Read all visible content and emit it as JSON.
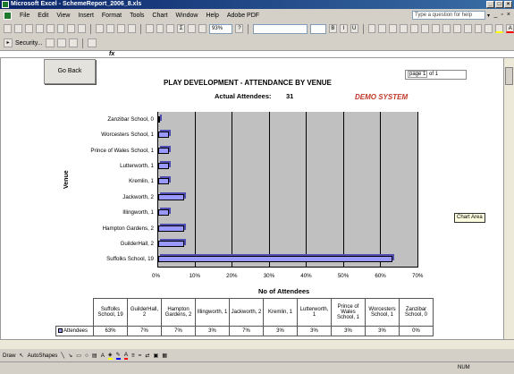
{
  "window": {
    "title": "Microsoft Excel - SchemeReport_2006_8.xls"
  },
  "menu": {
    "items": [
      "File",
      "Edit",
      "View",
      "Insert",
      "Format",
      "Tools",
      "Chart",
      "Window",
      "Help",
      "Adobe PDF"
    ]
  },
  "help_box": {
    "placeholder": "Type a question for help"
  },
  "toolbar": {
    "zoom": "93%",
    "security_label": "Security..."
  },
  "formula_bar": {
    "fx": "fx"
  },
  "report": {
    "go_back": "Go Back",
    "page_label": "page 1",
    "page_of": "of 1",
    "title": "PLAY DEVELOPMENT - ATTENDANCE BY VENUE",
    "actual_attendees_label": "Actual Attendees:",
    "actual_attendees_value": "31",
    "demo": "DEMO SYSTEM"
  },
  "chart_area_tooltip": "Chart Area",
  "chart_data": {
    "type": "bar",
    "orientation": "horizontal",
    "categories": [
      "Suffolks School, 19",
      "GuilderHall, 2",
      "Hampton Gardens, 2",
      "Illingworth, 1",
      "Jackworth, 2",
      "Kremlin, 1",
      "Lutterworth, 1",
      "Prince of Wales School, 1",
      "Worcesters School, 1",
      "Zanzibar School, 0"
    ],
    "table_headers": [
      "Suffolks School, 19",
      "GuilderHall, 2",
      "Hampton Gardens, 2",
      "Illingworth, 1",
      "Jackworth, 2",
      "Kremlin, 1",
      "Lutterworth, 1",
      "Prince of Wales School, 1",
      "Worcesters School, 1",
      "Zanzibar School, 0"
    ],
    "series": [
      {
        "name": "Attendees",
        "values": [
          63,
          7,
          7,
          3,
          7,
          3,
          3,
          3,
          3,
          0
        ],
        "labels": [
          "63%",
          "7%",
          "7%",
          "3%",
          "7%",
          "3%",
          "3%",
          "3%",
          "3%",
          "0%"
        ]
      }
    ],
    "xlabel": "No of Attendees",
    "ylabel": "Venue",
    "xlim": [
      0,
      70
    ],
    "xticks": [
      "0%",
      "10%",
      "20%",
      "30%",
      "40%",
      "50%",
      "60%",
      "70%"
    ],
    "grid": true,
    "plot_color": "#c0c0c0",
    "bar_color": "#9999ff"
  },
  "draw_toolbar": {
    "draw_label": "Draw",
    "autoshapes_label": "AutoShapes"
  },
  "status": {
    "num": "NUM"
  }
}
